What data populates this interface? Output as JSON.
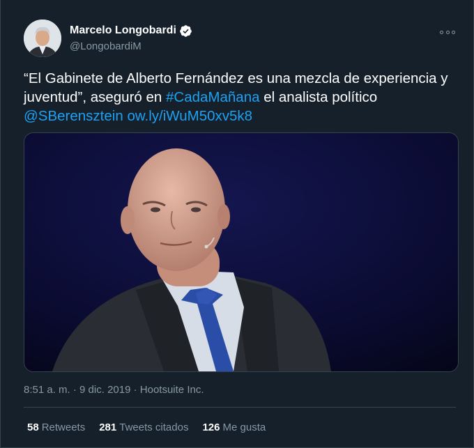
{
  "tweet": {
    "display_name": "Marcelo Longobardi",
    "handle": "@LongobardiM",
    "text_parts": {
      "t1": "“El Gabinete de Alberto Fernández es una mezcla de experiencia y juventud”, aseguró en ",
      "hashtag": "#CadaMañana",
      "t2": " el analista político ",
      "mention": "@SBerensztein",
      "t3": " ",
      "url": "ow.ly/iWuM50xv5k8"
    },
    "time": "8:51 a. m.",
    "date": "9 dic. 2019",
    "separator": "·",
    "source": "Hootsuite Inc.",
    "stats": {
      "retweets_count": "58",
      "retweets_label": "Retweets",
      "quotes_count": "281",
      "quotes_label": "Tweets citados",
      "likes_count": "126",
      "likes_label": "Me gusta"
    }
  },
  "colors": {
    "background": "#15202b",
    "link": "#1da1f2",
    "secondary_text": "#8899a6",
    "border": "#38444d",
    "verified": "#ffffff"
  },
  "icons": {
    "verified": "verified-badge-icon",
    "more": "more-options-icon"
  }
}
